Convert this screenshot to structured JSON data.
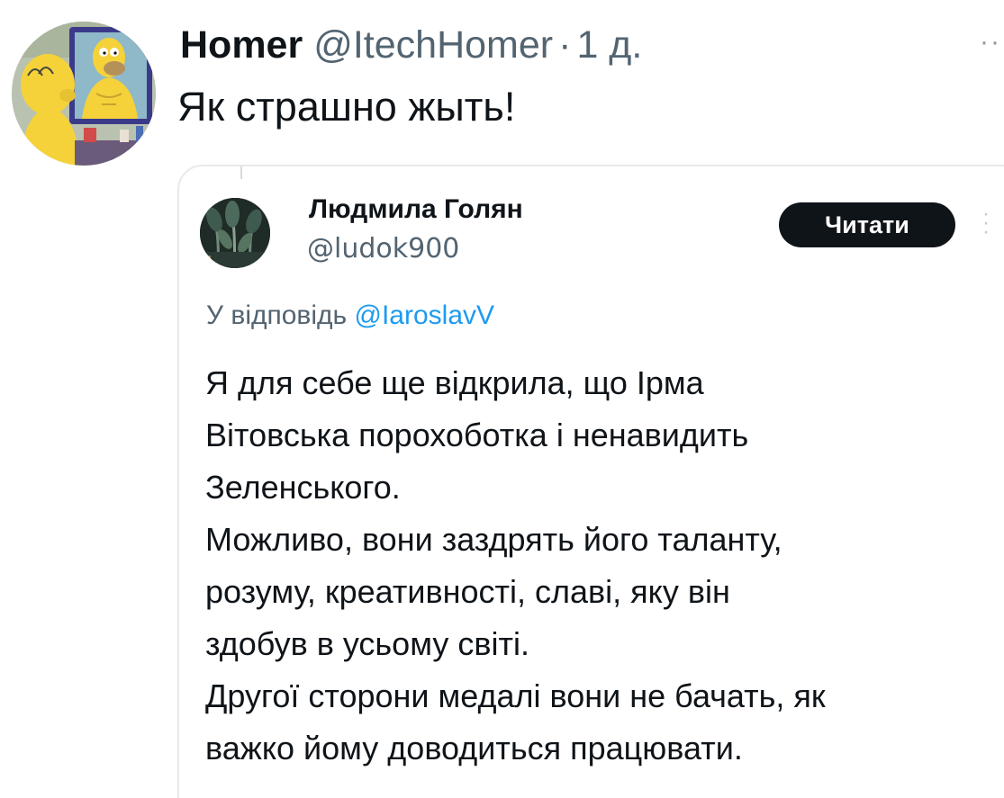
{
  "tweet": {
    "author": {
      "display_name": "Homer",
      "handle": "@ItechHomer",
      "avatar": "homer-simpson-mirror-avatar"
    },
    "separator": "·",
    "time": "1 д.",
    "more_icon": "more-dots-icon",
    "text": "Як страшно жыть!"
  },
  "quoted": {
    "author": {
      "display_name": "Людмила Голян",
      "handle": "@ludok900",
      "avatar": "dark-plant-avatar"
    },
    "follow_label": "Читати",
    "more_icon": "more-dots-vertical-icon",
    "reply_prefix": "У відповідь",
    "reply_mention": "@IaroslavV",
    "body_lines": [
      "Я для себе ще відкрила, що  Ірма",
      "Вітовська порохоботка і ненавидить",
      "Зеленського.",
      "Можливо, вони заздрять його таланту,",
      "розуму, креативності, славі, яку він",
      "здобув в усьому світі.",
      "Другої сторони медалі вони не бачать, як",
      "важко йому доводиться працювати."
    ]
  },
  "colors": {
    "text_primary": "#0f1419",
    "text_secondary": "#536471",
    "link": "#1d9bf0",
    "border": "#e7e9ea",
    "button_bg": "#0f1419",
    "button_text": "#ffffff"
  }
}
